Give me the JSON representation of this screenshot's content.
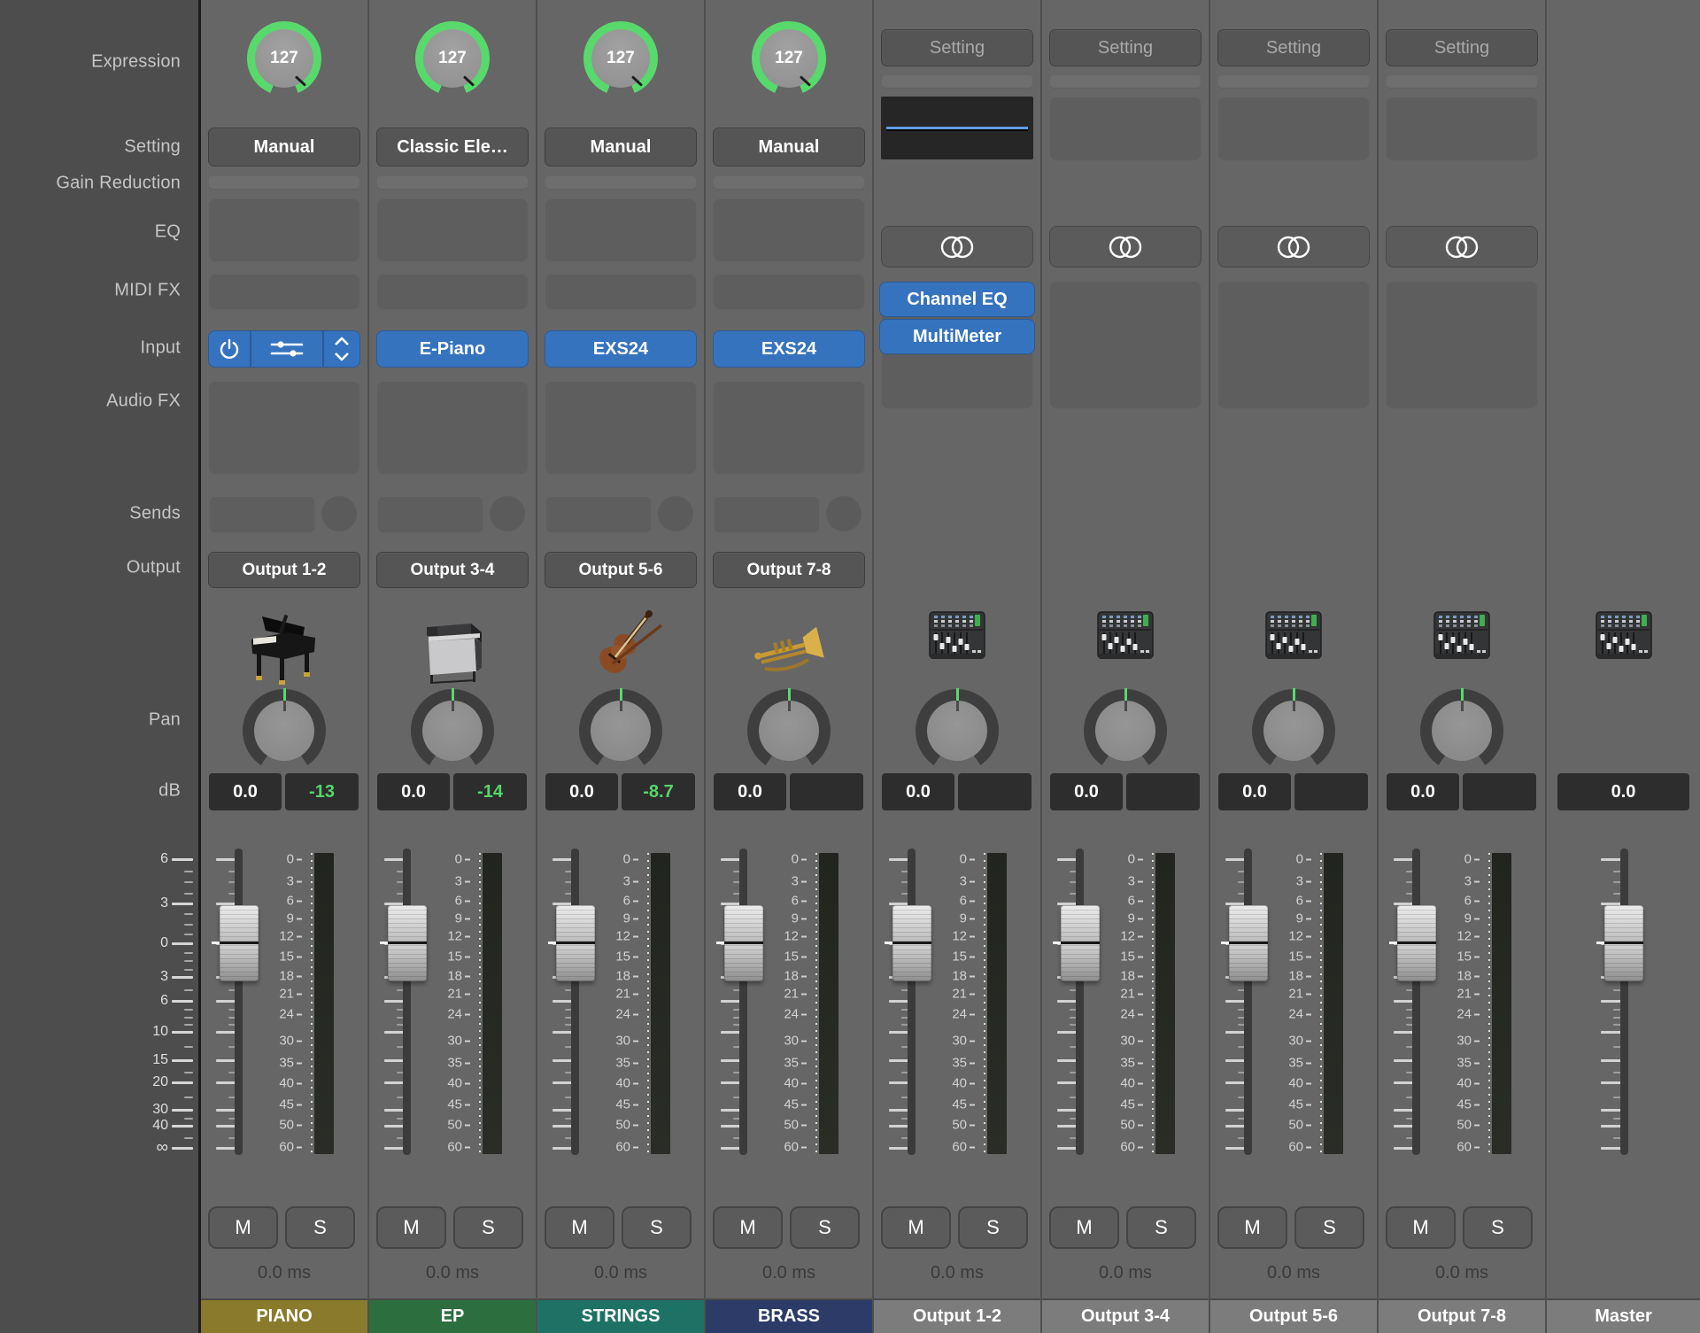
{
  "sidebar": {
    "labels": [
      "Expression",
      "Setting",
      "Gain Reduction",
      "EQ",
      "MIDI FX",
      "Input",
      "Audio FX",
      "Sends",
      "Output",
      "Pan",
      "dB"
    ],
    "fader_scale": [
      "6",
      "3",
      "0",
      "3",
      "6",
      "10",
      "15",
      "20",
      "30",
      "40",
      "∞"
    ]
  },
  "meter_scale": [
    "0",
    "3",
    "6",
    "9",
    "12",
    "15",
    "18",
    "21",
    "24",
    "30",
    "35",
    "40",
    "45",
    "50",
    "60"
  ],
  "buttons": {
    "mute_label": "M",
    "solo_label": "S"
  },
  "colors": {
    "accent_blue": "#3673bf",
    "value_green": "#57d56a",
    "arc_green": "#58d96c",
    "piano": "#8a7a2b",
    "ep": "#2d6e3e",
    "strings": "#1e7265",
    "brass": "#2c3b67",
    "output_name": "#7c7c7c"
  },
  "channels": [
    {
      "kind": "instrument",
      "name": "PIANO",
      "color": "#8a7a2b",
      "expression": "127",
      "setting": "Manual",
      "input": {
        "type": "controls",
        "icons": [
          "power-icon",
          "sliders-icon",
          "updown-icon"
        ]
      },
      "icon": "grand-piano",
      "db_main": "0.0",
      "db_second": "-13",
      "output": "Output 1-2",
      "latency": "0.0 ms"
    },
    {
      "kind": "instrument",
      "name": "EP",
      "color": "#2d6e3e",
      "expression": "127",
      "setting": "Classic Ele…",
      "input": {
        "type": "button",
        "label": "E-Piano"
      },
      "icon": "electric-piano",
      "db_main": "0.0",
      "db_second": "-14",
      "output": "Output 3-4",
      "latency": "0.0 ms"
    },
    {
      "kind": "instrument",
      "name": "STRINGS",
      "color": "#1e7265",
      "expression": "127",
      "setting": "Manual",
      "input": {
        "type": "button",
        "label": "EXS24"
      },
      "icon": "violin",
      "db_main": "0.0",
      "db_second": "-8.7",
      "output": "Output 5-6",
      "latency": "0.0 ms"
    },
    {
      "kind": "instrument",
      "name": "BRASS",
      "color": "#2c3b67",
      "expression": "127",
      "setting": "Manual",
      "input": {
        "type": "button",
        "label": "EXS24"
      },
      "icon": "brass",
      "db_main": "0.0",
      "db_second": "",
      "output": "Output 7-8",
      "latency": "0.0 ms"
    },
    {
      "kind": "output",
      "name": "Output 1-2",
      "color": "#7c7c7c",
      "setting": "Setting",
      "eq_thumbnail": true,
      "plugins": [
        "Channel EQ",
        "MultiMeter"
      ],
      "icon": "mixer",
      "db_main": "0.0",
      "db_second": "",
      "latency": "0.0 ms"
    },
    {
      "kind": "output",
      "name": "Output 3-4",
      "color": "#7c7c7c",
      "setting": "Setting",
      "eq_thumbnail": false,
      "plugins": [],
      "icon": "mixer",
      "db_main": "0.0",
      "db_second": "",
      "latency": "0.0 ms"
    },
    {
      "kind": "output",
      "name": "Output 5-6",
      "color": "#7c7c7c",
      "setting": "Setting",
      "eq_thumbnail": false,
      "plugins": [],
      "icon": "mixer",
      "db_main": "0.0",
      "db_second": "",
      "latency": "0.0 ms"
    },
    {
      "kind": "output",
      "name": "Output 7-8",
      "color": "#7c7c7c",
      "setting": "Setting",
      "eq_thumbnail": false,
      "plugins": [],
      "icon": "mixer",
      "db_main": "0.0",
      "db_second": "",
      "latency": "0.0 ms"
    },
    {
      "kind": "master",
      "name": "Master",
      "color": "#7c7c7c",
      "icon": "mixer",
      "db_main": "0.0"
    }
  ]
}
